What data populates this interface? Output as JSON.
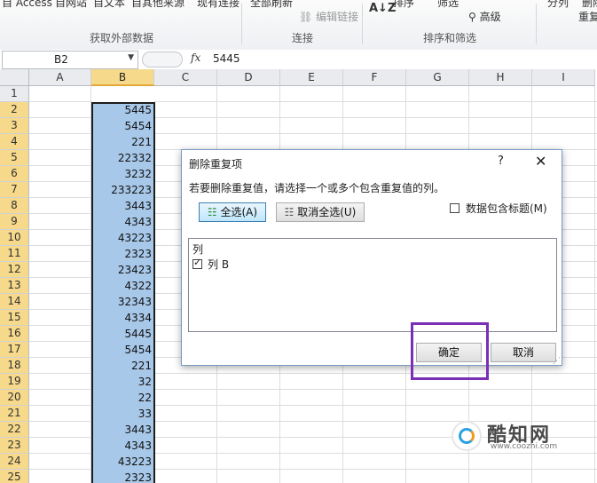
{
  "ribbon": {
    "top_items": [
      "自 Access",
      "自网站",
      "自文本",
      "自其他来源",
      "现有连接",
      "全部刷新",
      "编辑链接",
      "排序",
      "筛选",
      "高级",
      "分列",
      "删除",
      "重复"
    ],
    "groups": [
      "获取外部数据",
      "连接",
      "排序和筛选"
    ]
  },
  "formula_bar": {
    "name_box": "B2",
    "fx": "fx",
    "value": "5445"
  },
  "sheet": {
    "columns": [
      "A",
      "B",
      "C",
      "D",
      "E",
      "F",
      "G",
      "H",
      "I"
    ],
    "selected_column": "B",
    "rows": [
      "1",
      "2",
      "3",
      "4",
      "5",
      "6",
      "7",
      "8",
      "9",
      "10",
      "11",
      "12",
      "13",
      "14",
      "15",
      "16",
      "17",
      "18",
      "19",
      "20",
      "21",
      "22",
      "23",
      "24",
      "25"
    ],
    "b_values": [
      "",
      "5445",
      "5454",
      "221",
      "22332",
      "3232",
      "233223",
      "3443",
      "4343",
      "43223",
      "2323",
      "23423",
      "4322",
      "32343",
      "4334",
      "5445",
      "5454",
      "221",
      "32",
      "22",
      "33",
      "3443",
      "4343",
      "43223",
      "2323"
    ]
  },
  "dialog": {
    "title": "删除重复项",
    "help": "?",
    "close": "✕",
    "description": "若要删除重复值，请选择一个或多个包含重复值的列。",
    "select_all": "全选(A)",
    "unselect_all": "取消全选(U)",
    "header_checkbox": "数据包含标题(M)",
    "header_checked": false,
    "list_header": "列",
    "columns": [
      {
        "label": "列 B",
        "checked": true
      }
    ],
    "ok": "确定",
    "cancel": "取消"
  },
  "watermark": {
    "name": "酷知网",
    "url": "www.coozhi.com"
  },
  "colors": {
    "selection": "#a8c8e9",
    "header_highlight": "#f6d98a",
    "annotation": "#7a2fb5"
  }
}
